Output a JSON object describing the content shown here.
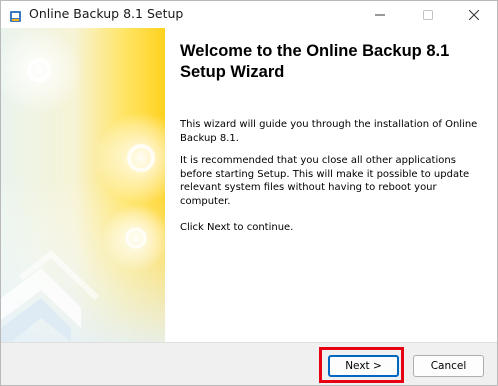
{
  "window": {
    "title": "Online Backup 8.1 Setup",
    "icon": "installer-icon"
  },
  "caption_buttons": [
    "minimize-icon",
    "maximize-icon",
    "close-icon"
  ],
  "content": {
    "heading": "Welcome to the Online Backup 8.1 Setup Wizard",
    "paragraph1": "This wizard will guide you through the installation of Online Backup 8.1.",
    "paragraph2": "It is recommended that you close all other applications before starting Setup. This will make it possible to update relevant system files without having to reboot your computer.",
    "paragraph3": "Click Next to continue."
  },
  "buttons": {
    "next": "Next >",
    "cancel": "Cancel"
  },
  "colors": {
    "accent": "#0067c0",
    "highlight": "#e60012",
    "sidebar_yellow": "#ffd21f"
  }
}
